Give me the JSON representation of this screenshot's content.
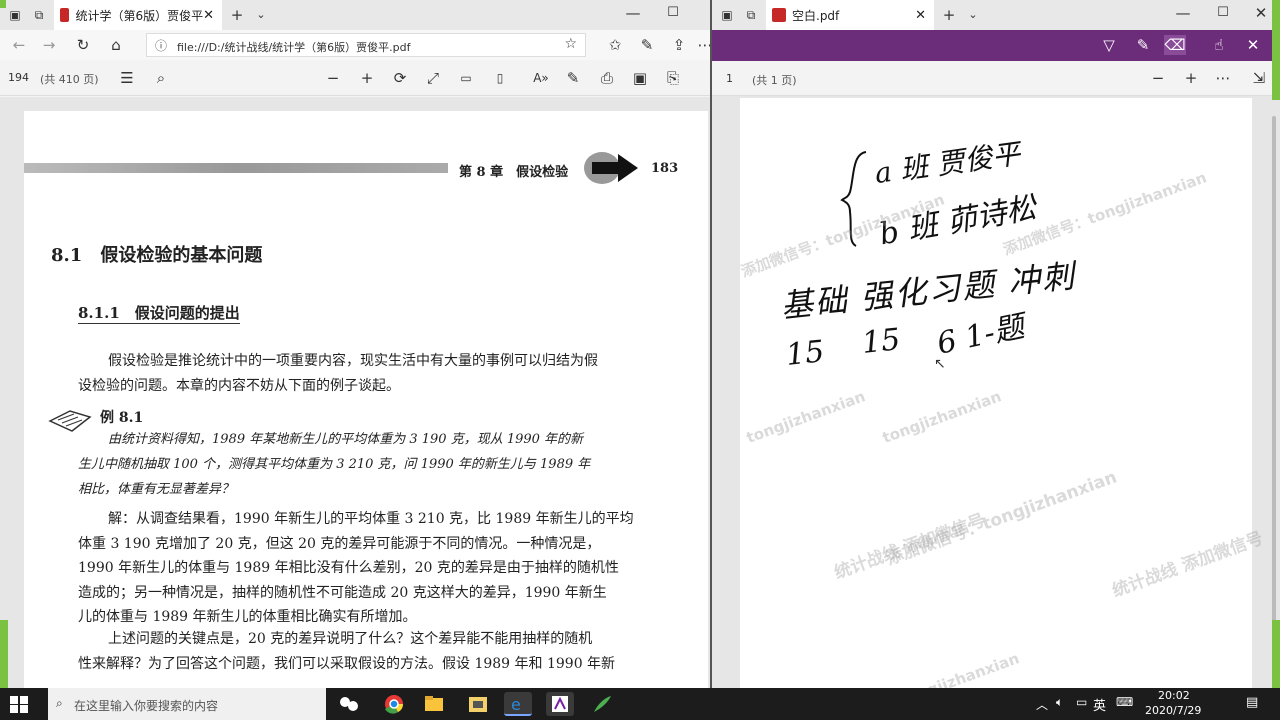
{
  "left_window": {
    "tab_title": "统计学（第6版）贾俊平",
    "address": "file:///D:/统计战线/统计学（第6版）贾俊平.pdf",
    "page_number": "194",
    "page_count": "(共 410 页)",
    "content": {
      "chapter_header": "第 8 章　假设检验",
      "page_no": "183",
      "section_title": "8.1　假设检验的基本问题",
      "subsection_title": "8.1.1　假设问题的提出",
      "para1_line1": "假设检验是推论统计中的一项重要内容，现实生活中有大量的事例可以归结为假",
      "para1_line2": "设检验的问题。本章的内容不妨从下面的例子谈起。",
      "example_label": "例 8.1",
      "example_line1": "由统计资料得知，1989 年某地新生儿的平均体重为 3 190 克，现从 1990 年的新",
      "example_line2": "生儿中随机抽取 100 个，测得其平均体重为 3 210 克，问 1990 年的新生儿与 1989 年",
      "example_line3": "相比，体重有无显著差异？",
      "sol_line1": "解：从调查结果看，1990 年新生儿的平均体重 3 210 克，比 1989 年新生儿的平均",
      "sol_line2": "体重 3 190 克增加了 20 克，但这 20 克的差异可能源于不同的情况。一种情况是，",
      "sol_line3": "1990 年新生儿的体重与 1989 年相比没有什么差别，20 克的差异是由于抽样的随机性",
      "sol_line4": "造成的；另一种情况是，抽样的随机性不可能造成 20 克这样大的差异，1990 年新生",
      "sol_line5": "儿的体重与 1989 年新生儿的体重相比确实有所增加。",
      "para3_line1": "上述问题的关键点是，20 克的差异说明了什么？这个差异能不能用抽样的随机",
      "para3_line2": "性来解释？为了回答这个问题，我们可以采取假设的方法。假设 1989 年和 1990 年新"
    }
  },
  "right_window": {
    "tab_title": "空白.pdf",
    "page_number": "1",
    "page_count": "(共 1 页)",
    "handwriting": {
      "line1": "a 班 贾俊平",
      "line2": "b 班 茆诗松",
      "line3": "基础  强化习题  冲刺",
      "line4_a": "15",
      "line4_b": "15",
      "line4_c": "6 1-题"
    }
  },
  "watermarks": {
    "latin": "tongjizhanxian",
    "wechat": "添加微信号：tongjizhanxian",
    "chinese": "统计战线  添加微信号"
  },
  "taskbar": {
    "search_placeholder": "在这里输入你要搜索的内容",
    "ime": "英",
    "time": "20:02",
    "date": "2020/7/29"
  },
  "colors": {
    "accent_purple": "#6b2c7a",
    "taskbar": "#1c1c1c",
    "green_frame": "#7cc242"
  }
}
